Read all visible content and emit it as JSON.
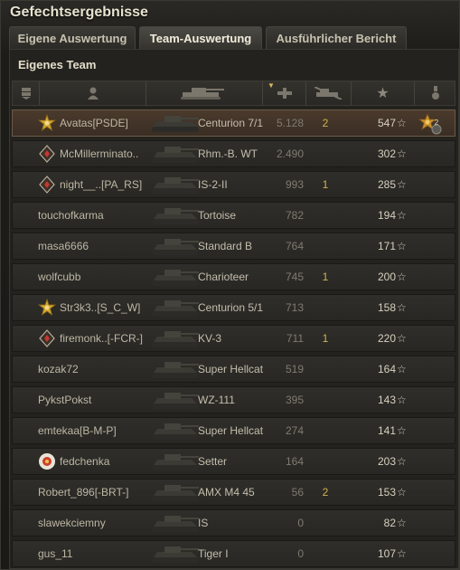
{
  "window": {
    "title": "Gefechtsergebnisse"
  },
  "tabs": [
    {
      "label": "Eigene Auswertung",
      "active": false
    },
    {
      "label": "Team-Auswertung",
      "active": true
    },
    {
      "label": "Ausführlicher Bericht",
      "active": false
    }
  ],
  "team": {
    "title": "Eigenes Team"
  },
  "columns": [
    {
      "icon": "squad-icon"
    },
    {
      "icon": "player-icon"
    },
    {
      "icon": "tank-icon"
    },
    {
      "icon": "damage-icon",
      "sorted": "desc"
    },
    {
      "icon": "kills-icon"
    },
    {
      "icon": "xp-star-icon"
    },
    {
      "icon": "medal-icon"
    }
  ],
  "colors": {
    "accent": "#d1b24f",
    "highlight_row": "#4a3a2c",
    "row": "#2f2e2a"
  },
  "rows": [
    {
      "name": "Avatas[PSDE]",
      "badge": "gold-badge-icon",
      "tank": "Centurion 7/1",
      "damage": "5.128",
      "kills": "2",
      "xp": "547",
      "me": true,
      "medal": "2"
    },
    {
      "name": "McMillerminato..",
      "badge": "red-diamond-icon",
      "tank": "Rhm.-B. WT",
      "damage": "2.490",
      "kills": "",
      "xp": "302",
      "me": false,
      "medal": ""
    },
    {
      "name": "night__..[PA_RS]",
      "badge": "red-diamond-icon",
      "tank": "IS-2-II",
      "damage": "993",
      "kills": "1",
      "xp": "285",
      "me": false,
      "medal": ""
    },
    {
      "name": "touchofkarma",
      "badge": "",
      "tank": "Tortoise",
      "damage": "782",
      "kills": "",
      "xp": "194",
      "me": false,
      "medal": ""
    },
    {
      "name": "masa6666",
      "badge": "",
      "tank": "Standard B",
      "damage": "764",
      "kills": "",
      "xp": "171",
      "me": false,
      "medal": ""
    },
    {
      "name": "wolfcubb",
      "badge": "",
      "tank": "Charioteer",
      "damage": "745",
      "kills": "1",
      "xp": "200",
      "me": false,
      "medal": ""
    },
    {
      "name": "Str3k3..[S_C_W]",
      "badge": "gold-badge-icon",
      "tank": "Centurion 5/1",
      "damage": "713",
      "kills": "",
      "xp": "158",
      "me": false,
      "medal": ""
    },
    {
      "name": "firemonk..[-FCR-]",
      "badge": "red-diamond-icon",
      "tank": "KV-3",
      "damage": "711",
      "kills": "1",
      "xp": "220",
      "me": false,
      "medal": ""
    },
    {
      "name": "kozak72",
      "badge": "",
      "tank": "Super Hellcat",
      "damage": "519",
      "kills": "",
      "xp": "164",
      "me": false,
      "medal": ""
    },
    {
      "name": "PykstPokst",
      "badge": "",
      "tank": "WZ-111",
      "damage": "395",
      "kills": "",
      "xp": "143",
      "me": false,
      "medal": ""
    },
    {
      "name": "emtekaa[B-M-P]",
      "badge": "",
      "tank": "Super Hellcat",
      "damage": "274",
      "kills": "",
      "xp": "141",
      "me": false,
      "medal": ""
    },
    {
      "name": "fedchenka",
      "badge": "clan-emblem-icon",
      "tank": "Setter",
      "damage": "164",
      "kills": "",
      "xp": "203",
      "me": false,
      "medal": ""
    },
    {
      "name": "Robert_896[-BRT-]",
      "badge": "",
      "tank": "AMX M4 45",
      "damage": "56",
      "kills": "2",
      "xp": "153",
      "me": false,
      "medal": ""
    },
    {
      "name": "slawekciemny",
      "badge": "",
      "tank": "IS",
      "damage": "0",
      "kills": "",
      "xp": "82",
      "me": false,
      "medal": ""
    },
    {
      "name": "gus_11",
      "badge": "",
      "tank": "Tiger I",
      "damage": "0",
      "kills": "",
      "xp": "107",
      "me": false,
      "medal": ""
    }
  ]
}
